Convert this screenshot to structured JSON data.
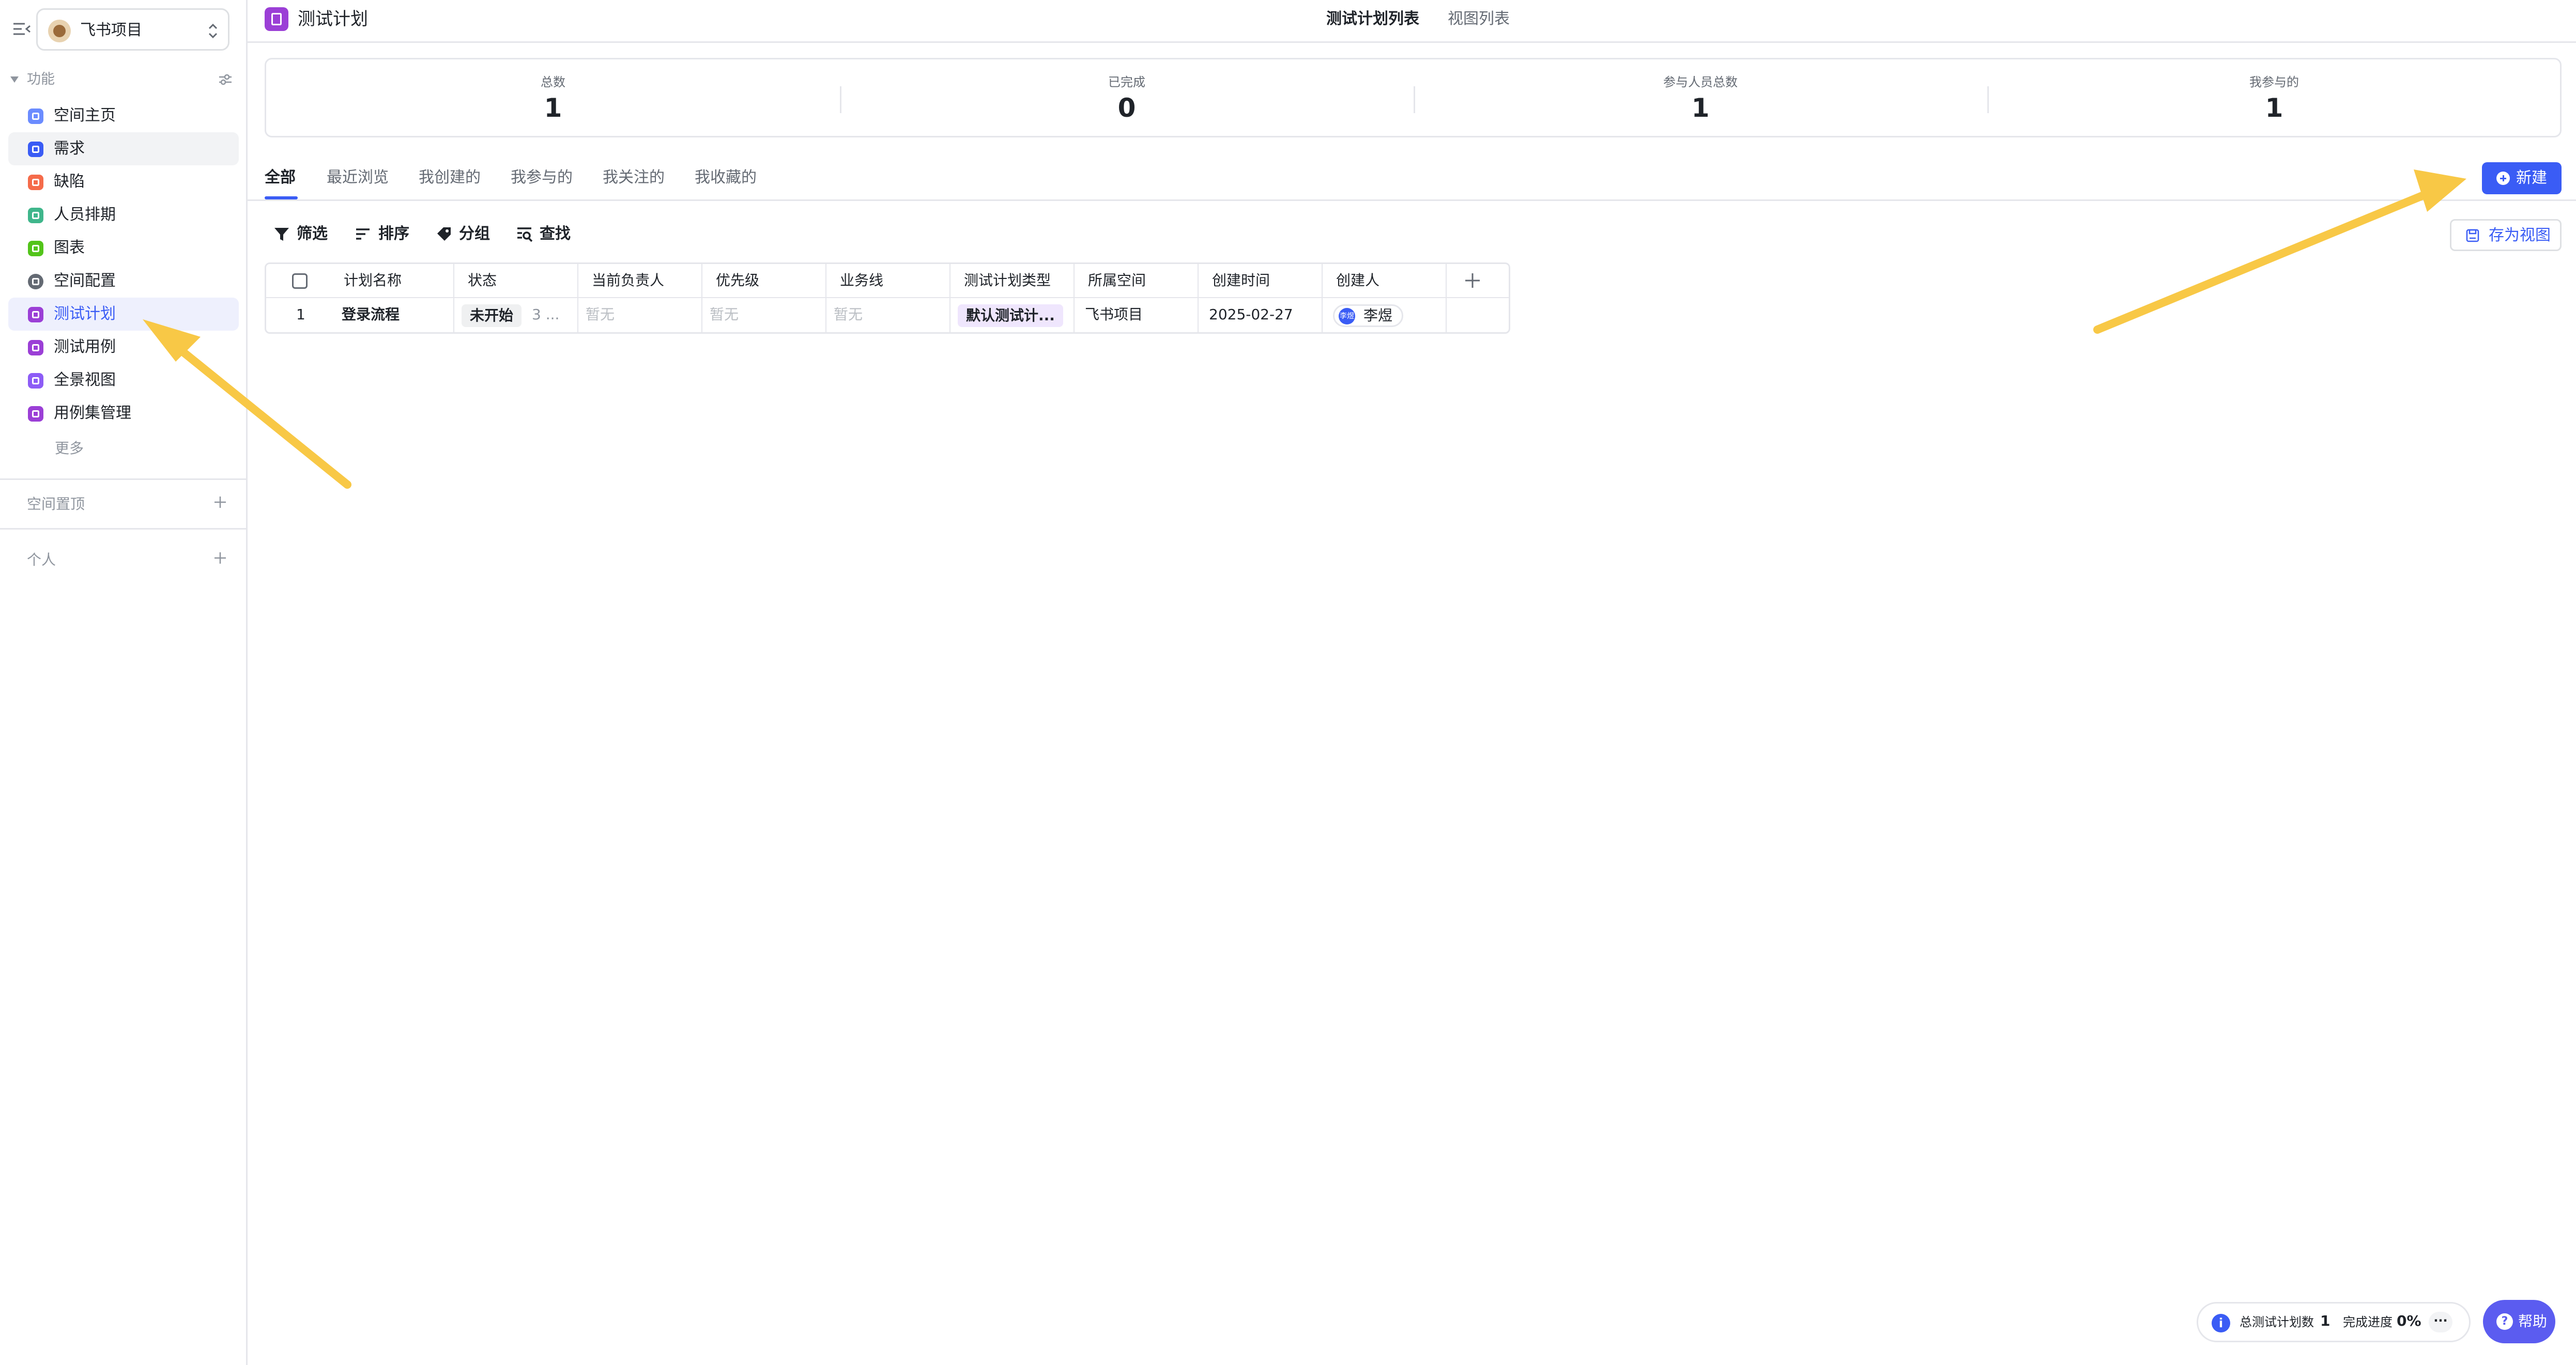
{
  "sidebar": {
    "project_name": "飞书项目",
    "section_label": "功能",
    "items": [
      {
        "label": "空间主页",
        "icon": "home-icon",
        "color": "#6b8cff"
      },
      {
        "label": "需求",
        "icon": "requirement-icon",
        "color": "#3a5cf5"
      },
      {
        "label": "缺陷",
        "icon": "bug-icon",
        "color": "#f56b4a"
      },
      {
        "label": "人员排期",
        "icon": "schedule-icon",
        "color": "#3fb68b"
      },
      {
        "label": "图表",
        "icon": "chart-icon",
        "color": "#52c41a"
      },
      {
        "label": "空间配置",
        "icon": "settings-icon",
        "color": "#646a73"
      },
      {
        "label": "测试计划",
        "icon": "test-plan-icon",
        "color": "#9b3fd6"
      },
      {
        "label": "测试用例",
        "icon": "test-case-icon",
        "color": "#9b3fd6"
      },
      {
        "label": "全景视图",
        "icon": "panorama-icon",
        "color": "#8d5cf6"
      },
      {
        "label": "用例集管理",
        "icon": "case-set-icon",
        "color": "#9b3fd6"
      }
    ],
    "more_label": "更多",
    "pinned_label": "空间置顶",
    "personal_label": "个人"
  },
  "header": {
    "title": "测试计划",
    "tabs": [
      "测试计划列表",
      "视图列表"
    ]
  },
  "stats": [
    {
      "label": "总数",
      "value": "1"
    },
    {
      "label": "已完成",
      "value": "0"
    },
    {
      "label": "参与人员总数",
      "value": "1"
    },
    {
      "label": "我参与的",
      "value": "1"
    }
  ],
  "filter_tabs": [
    "全部",
    "最近浏览",
    "我创建的",
    "我参与的",
    "我关注的",
    "我收藏的"
  ],
  "actions": {
    "new_label": "新建",
    "save_view_label": "存为视图"
  },
  "toolbar": {
    "filter": "筛选",
    "sort": "排序",
    "group": "分组",
    "find": "查找"
  },
  "table": {
    "columns": [
      "计划名称",
      "状态",
      "当前负责人",
      "优先级",
      "业务线",
      "测试计划类型",
      "所属空间",
      "创建时间",
      "创建人"
    ],
    "rows": [
      {
        "index": "1",
        "name": "登录流程",
        "status": "未开始",
        "status_extra": "3 ...",
        "owner": "暂无",
        "priority": "暂无",
        "business_line": "暂无",
        "type": "默认测试计...",
        "space": "飞书项目",
        "created_at": "2025-02-27",
        "creator": "李煜",
        "creator_avatar": "李煜"
      }
    ]
  },
  "bottom_bar": {
    "total_label": "总测试计划数",
    "total_value": "1",
    "progress_label": "完成进度",
    "progress_value": "0%",
    "more": "···",
    "help_label": "帮助"
  },
  "colors": {
    "accent": "#3a5cf5",
    "annotation_arrow": "#f8c846"
  }
}
